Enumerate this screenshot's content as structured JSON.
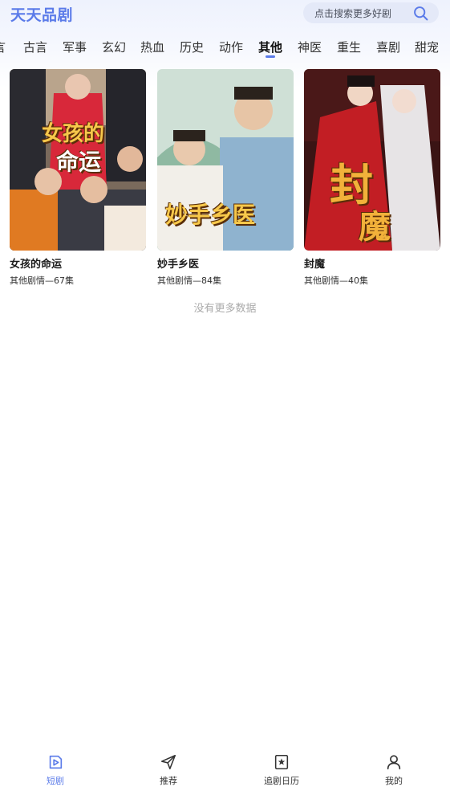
{
  "app": {
    "title": "天天品剧"
  },
  "search": {
    "placeholder": "点击搜索更多好剧",
    "icon": "search-icon"
  },
  "categories": {
    "tabs": [
      "言",
      "古言",
      "军事",
      "玄幻",
      "热血",
      "历史",
      "动作",
      "其他",
      "神医",
      "重生",
      "喜剧",
      "甜宠"
    ],
    "active": "其他"
  },
  "dramas": [
    {
      "title": "女孩的命运",
      "meta": "其他剧情—67集",
      "poster_text": [
        "女孩的",
        "命运"
      ]
    },
    {
      "title": "妙手乡医",
      "meta": "其他剧情—84集",
      "poster_text": [
        "妙手乡医"
      ]
    },
    {
      "title": "封魔",
      "meta": "其他剧情—40集",
      "poster_text": [
        "封",
        "魔"
      ]
    }
  ],
  "status": {
    "no_more": "没有更多数据"
  },
  "bottom_nav": {
    "items": [
      {
        "label": "短剧",
        "icon": "play-icon",
        "active": true
      },
      {
        "label": "推荐",
        "icon": "send-icon",
        "active": false
      },
      {
        "label": "追剧日历",
        "icon": "bookmark-star-icon",
        "active": false
      },
      {
        "label": "我的",
        "icon": "user-icon",
        "active": false
      }
    ]
  },
  "colors": {
    "accent": "#5b7be9",
    "muted": "#aaaaaa"
  }
}
